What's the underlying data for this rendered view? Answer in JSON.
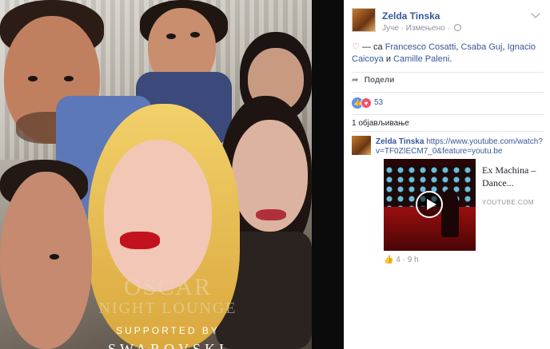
{
  "photo": {
    "overlay_line1": "OSCAR",
    "overlay_line2": "NIGHT LOUNGE",
    "overlay_supported": "SUPPORTED BY",
    "overlay_brand": "SWAROVSKI"
  },
  "post": {
    "author": "Zelda Tinska",
    "time": "Јуче",
    "edited": "Измењено",
    "separator": "·",
    "tag_prefix": "— са",
    "tags": [
      "Francesco Cosatti",
      "Csaba Guj",
      "Ignacio Caicoya"
    ],
    "tag_conjunction": "и",
    "tag_last": "Camille Paleni",
    "share_label": "Подели",
    "reaction_count": "53",
    "shares_label": "1 објављивање"
  },
  "shared": {
    "author": "Zelda Tinska",
    "url": "https://www.youtube.com/watch?v=TF0ZIECM7_0&feature=youtu.be",
    "card_title": "Ex Machina – Dance...",
    "card_domain": "YOUTUBE.COM",
    "likes": "4",
    "age": "9 h"
  },
  "colors": {
    "link": "#365899",
    "muted": "#90949c",
    "like": "#5890ff",
    "love": "#f25268"
  }
}
